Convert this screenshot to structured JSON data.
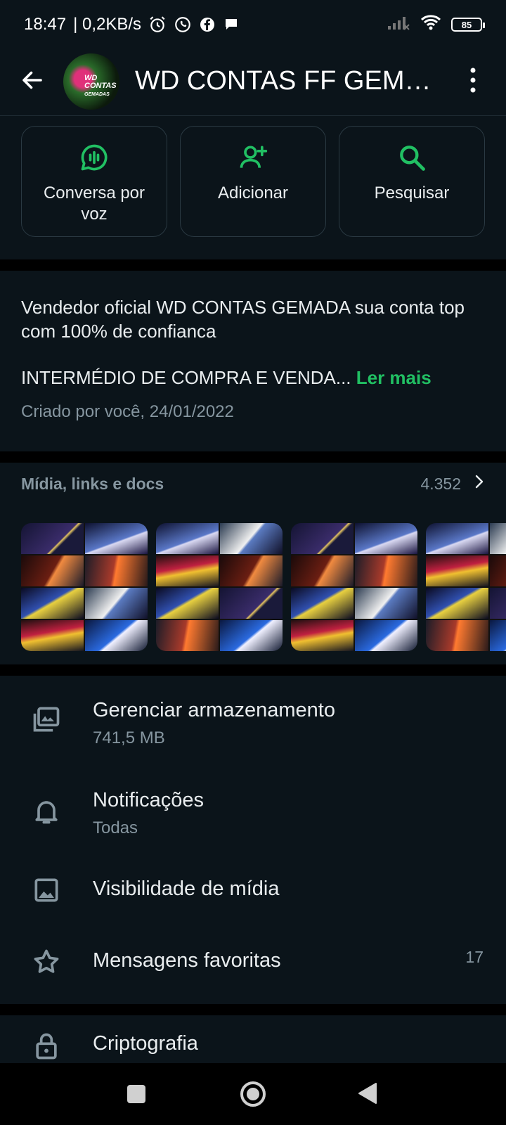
{
  "status_bar": {
    "time": "18:47",
    "speed": "| 0,2KB/s",
    "battery": "85"
  },
  "header": {
    "title": "WD CONTAS FF GEMA...",
    "avatar_text_line1": "WD CONTAS",
    "avatar_text_line2": "GEMADAS"
  },
  "actions": [
    {
      "label": "Conversa por voz",
      "icon": "voice-chat-icon"
    },
    {
      "label": "Adicionar",
      "icon": "add-person-icon"
    },
    {
      "label": "Pesquisar",
      "icon": "search-icon"
    }
  ],
  "description": {
    "line1": "Vendedor oficial WD CONTAS GEMADA sua conta top com 100% de confianca",
    "line2": "INTERMÉDIO DE COMPRA E VENDA...",
    "read_more": "Ler mais",
    "created": "Criado por você, 24/01/2022"
  },
  "media": {
    "title": "Mídia, links e docs",
    "count": "4.352"
  },
  "settings": [
    {
      "title": "Gerenciar armazenamento",
      "subtitle": "741,5 MB",
      "icon": "storage-icon"
    },
    {
      "title": "Notificações",
      "subtitle": "Todas",
      "icon": "bell-icon"
    },
    {
      "title": "Visibilidade de mídia",
      "subtitle": "",
      "icon": "image-icon"
    },
    {
      "title": "Mensagens favoritas",
      "subtitle": "",
      "badge": "17",
      "icon": "star-icon"
    },
    {
      "title": "Criptografia",
      "subtitle": "",
      "icon": "lock-icon"
    }
  ],
  "colors": {
    "background": "#0b141a",
    "accent": "#21c063",
    "muted": "#8696a0"
  }
}
